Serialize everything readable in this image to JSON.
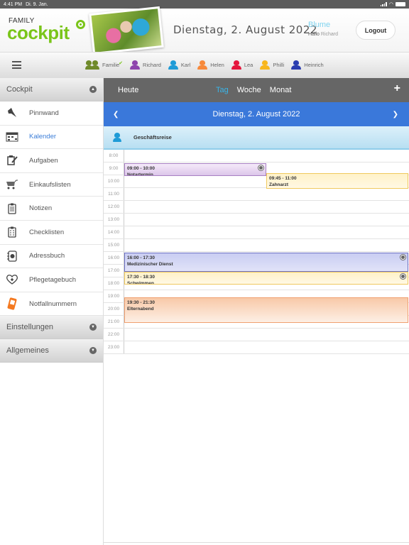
{
  "status_bar": {
    "time": "4:41 PM",
    "date": "Di. 9. Jan."
  },
  "header": {
    "logo_top": "FAMILY",
    "logo_main": "cockpit",
    "date": "Dienstag, 2. August 2022",
    "family_name": "Blume",
    "greeting_prefix": "Hallo",
    "user_name": "Richard",
    "logout_label": "Logout"
  },
  "members": [
    {
      "name": "Familie",
      "color": "#6f8a2a",
      "selected": true,
      "group": true
    },
    {
      "name": "Richard",
      "color": "#8e44ad"
    },
    {
      "name": "Karl",
      "color": "#1e9bd7"
    },
    {
      "name": "Helen",
      "color": "#f7893b"
    },
    {
      "name": "Lea",
      "color": "#e5163d"
    },
    {
      "name": "Philli",
      "color": "#f8b61c"
    },
    {
      "name": "Heinrich",
      "color": "#2b3eb0"
    }
  ],
  "sidebar": {
    "cockpit_label": "Cockpit",
    "items": [
      {
        "label": "Pinnwand",
        "icon": "pin-icon"
      },
      {
        "label": "Kalender",
        "icon": "calendar-icon",
        "active": true
      },
      {
        "label": "Aufgaben",
        "icon": "tasks-icon"
      },
      {
        "label": "Einkaufslisten",
        "icon": "cart-icon"
      },
      {
        "label": "Notizen",
        "icon": "notes-icon"
      },
      {
        "label": "Checklisten",
        "icon": "checklist-icon"
      },
      {
        "label": "Adressbuch",
        "icon": "addressbook-icon"
      },
      {
        "label": "Pflegetagebuch",
        "icon": "heart-plus-icon"
      },
      {
        "label": "Notfallnummern",
        "icon": "emergency-phone-icon"
      }
    ],
    "settings_label": "Einstellungen",
    "general_label": "Allgemeines"
  },
  "calendar": {
    "today_label": "Heute",
    "views": [
      "Tag",
      "Woche",
      "Monat"
    ],
    "active_view": "Tag",
    "nav_date": "Dienstag, 2. August 2022",
    "allday_event": {
      "title": "Geschäftsreise",
      "member": "Karl",
      "color": "#1e9bd7"
    },
    "hours": [
      "8:00",
      "9:00",
      "10:00",
      "11:00",
      "12:00",
      "13:00",
      "14:00",
      "15:00",
      "16:00",
      "17:00",
      "18:00",
      "19:00",
      "20:00",
      "21:00",
      "22:00",
      "23:00"
    ],
    "events": [
      {
        "time": "09:00 - 10:00",
        "title": "Notartermin",
        "start": 9.0,
        "end": 10.0,
        "column": 0,
        "columns": 2,
        "style": "purple",
        "has_icon": true
      },
      {
        "time": "09:45 - 11:00",
        "title": "Zahnarzt",
        "start": 9.75,
        "end": 11.0,
        "column": 1,
        "columns": 2,
        "style": "yellow",
        "has_icon": false
      },
      {
        "time": "16:00 - 17:30",
        "title": "Medizinischer Dienst",
        "start": 16.0,
        "end": 17.5,
        "column": 0,
        "columns": 1,
        "style": "blue",
        "has_icon": true
      },
      {
        "time": "17:30 - 18:30",
        "title": "Schwimmen",
        "start": 17.5,
        "end": 18.5,
        "column": 0,
        "columns": 1,
        "style": "yellow",
        "has_icon": true
      },
      {
        "time": "19:30 - 21:30",
        "title": "Elternabend",
        "start": 19.5,
        "end": 21.5,
        "column": 0,
        "columns": 1,
        "style": "orange",
        "has_icon": false
      }
    ]
  }
}
